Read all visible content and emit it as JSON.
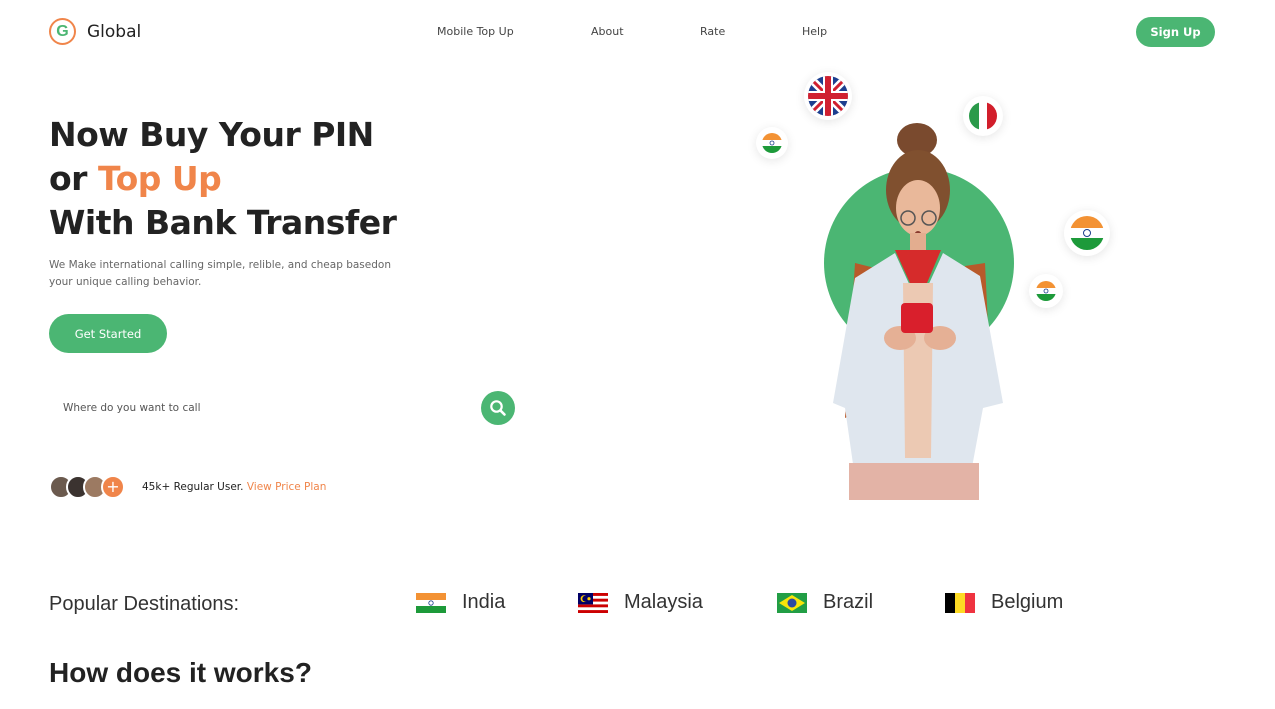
{
  "brand": {
    "logo_letter": "G",
    "name": "Global"
  },
  "nav": {
    "items": [
      "Mobile Top Up",
      "About",
      "Rate",
      "Help"
    ],
    "signup_label": "Sign Up"
  },
  "hero": {
    "title_line1": "Now Buy Your PIN",
    "title_line2_prefix": "or ",
    "title_line2_accent": "Top Up",
    "title_line3": "With Bank Transfer",
    "subtitle": "We Make international calling simple, relible, and cheap basedon your unique calling behavior.",
    "cta_label": "Get Started",
    "search_placeholder": "Where do you want to call",
    "users_count_text": "45k+ Regular User.",
    "users_link": "View Price Plan"
  },
  "destinations": {
    "label": "Popular Destinations:",
    "items": [
      "India",
      "Malaysia",
      "Brazil",
      "Belgium"
    ]
  },
  "section": {
    "how_bold": "How does",
    "how_rest": " it works?"
  },
  "colors": {
    "accent_green": "#4bb673",
    "accent_orange": "#f0854a"
  }
}
